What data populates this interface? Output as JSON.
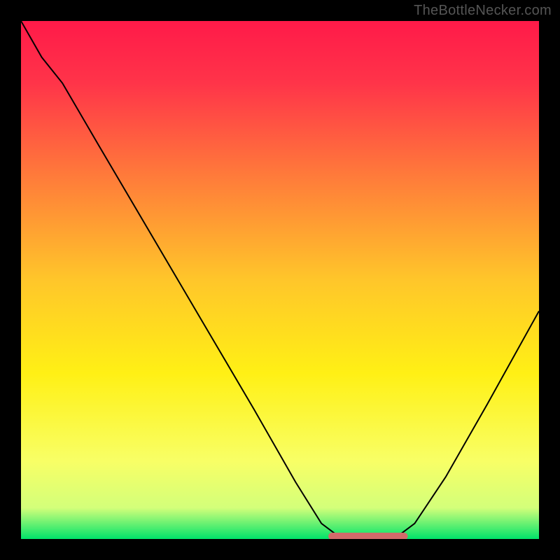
{
  "watermark": "TheBottleNecker.com",
  "chart_data": {
    "type": "line",
    "title": "",
    "xlabel": "",
    "ylabel": "",
    "xlim": [
      0,
      100
    ],
    "ylim": [
      0,
      100
    ],
    "gradient_stops": [
      {
        "offset": 0.0,
        "color": "#ff1a49"
      },
      {
        "offset": 0.12,
        "color": "#ff3449"
      },
      {
        "offset": 0.3,
        "color": "#ff7b3a"
      },
      {
        "offset": 0.5,
        "color": "#ffc62a"
      },
      {
        "offset": 0.68,
        "color": "#fff015"
      },
      {
        "offset": 0.85,
        "color": "#f8ff66"
      },
      {
        "offset": 0.94,
        "color": "#d3ff7a"
      },
      {
        "offset": 1.0,
        "color": "#00e36a"
      }
    ],
    "curve": [
      {
        "x": 0,
        "y": 100
      },
      {
        "x": 4,
        "y": 93
      },
      {
        "x": 8,
        "y": 88
      },
      {
        "x": 15,
        "y": 76
      },
      {
        "x": 25,
        "y": 59
      },
      {
        "x": 35,
        "y": 42
      },
      {
        "x": 45,
        "y": 25
      },
      {
        "x": 53,
        "y": 11
      },
      {
        "x": 58,
        "y": 3
      },
      {
        "x": 62,
        "y": 0
      },
      {
        "x": 72,
        "y": 0
      },
      {
        "x": 76,
        "y": 3
      },
      {
        "x": 82,
        "y": 12
      },
      {
        "x": 90,
        "y": 26
      },
      {
        "x": 100,
        "y": 44
      }
    ],
    "highlight_segment": {
      "x_start": 60,
      "x_end": 74,
      "y": 0,
      "color": "#d36a6a"
    }
  }
}
